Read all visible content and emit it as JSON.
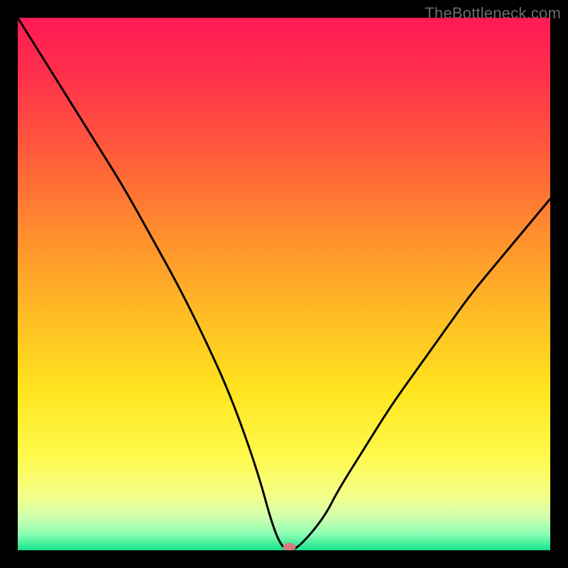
{
  "watermark": "TheBottleneck.com",
  "chart_data": {
    "type": "line",
    "title": "",
    "xlabel": "",
    "ylabel": "",
    "xlim": [
      0,
      100
    ],
    "ylim": [
      0,
      100
    ],
    "x": [
      0,
      5,
      10,
      15,
      20,
      25,
      30,
      35,
      40,
      45,
      48,
      50,
      52,
      55,
      58,
      60,
      65,
      70,
      75,
      80,
      85,
      90,
      95,
      100
    ],
    "values": [
      100,
      92,
      84,
      76,
      68,
      59,
      50,
      40,
      29,
      15,
      4,
      0,
      0,
      3,
      7,
      11,
      19,
      27,
      34,
      41,
      48,
      54,
      60,
      66
    ],
    "grid": false,
    "legend": false,
    "marker": {
      "x": 51,
      "y": 0.6,
      "color": "#d47d7a",
      "rx": 9,
      "ry": 6
    },
    "background_gradient": {
      "stops": [
        {
          "offset": 0.0,
          "color": "#ff1a54"
        },
        {
          "offset": 0.1,
          "color": "#ff2e4d"
        },
        {
          "offset": 0.25,
          "color": "#ff5a3b"
        },
        {
          "offset": 0.4,
          "color": "#ff8c2e"
        },
        {
          "offset": 0.55,
          "color": "#ffba25"
        },
        {
          "offset": 0.7,
          "color": "#ffe41f"
        },
        {
          "offset": 0.82,
          "color": "#fff94a"
        },
        {
          "offset": 0.9,
          "color": "#f4ff8a"
        },
        {
          "offset": 0.94,
          "color": "#ccffb0"
        },
        {
          "offset": 0.97,
          "color": "#8affb4"
        },
        {
          "offset": 1.0,
          "color": "#14e38a"
        }
      ]
    }
  }
}
